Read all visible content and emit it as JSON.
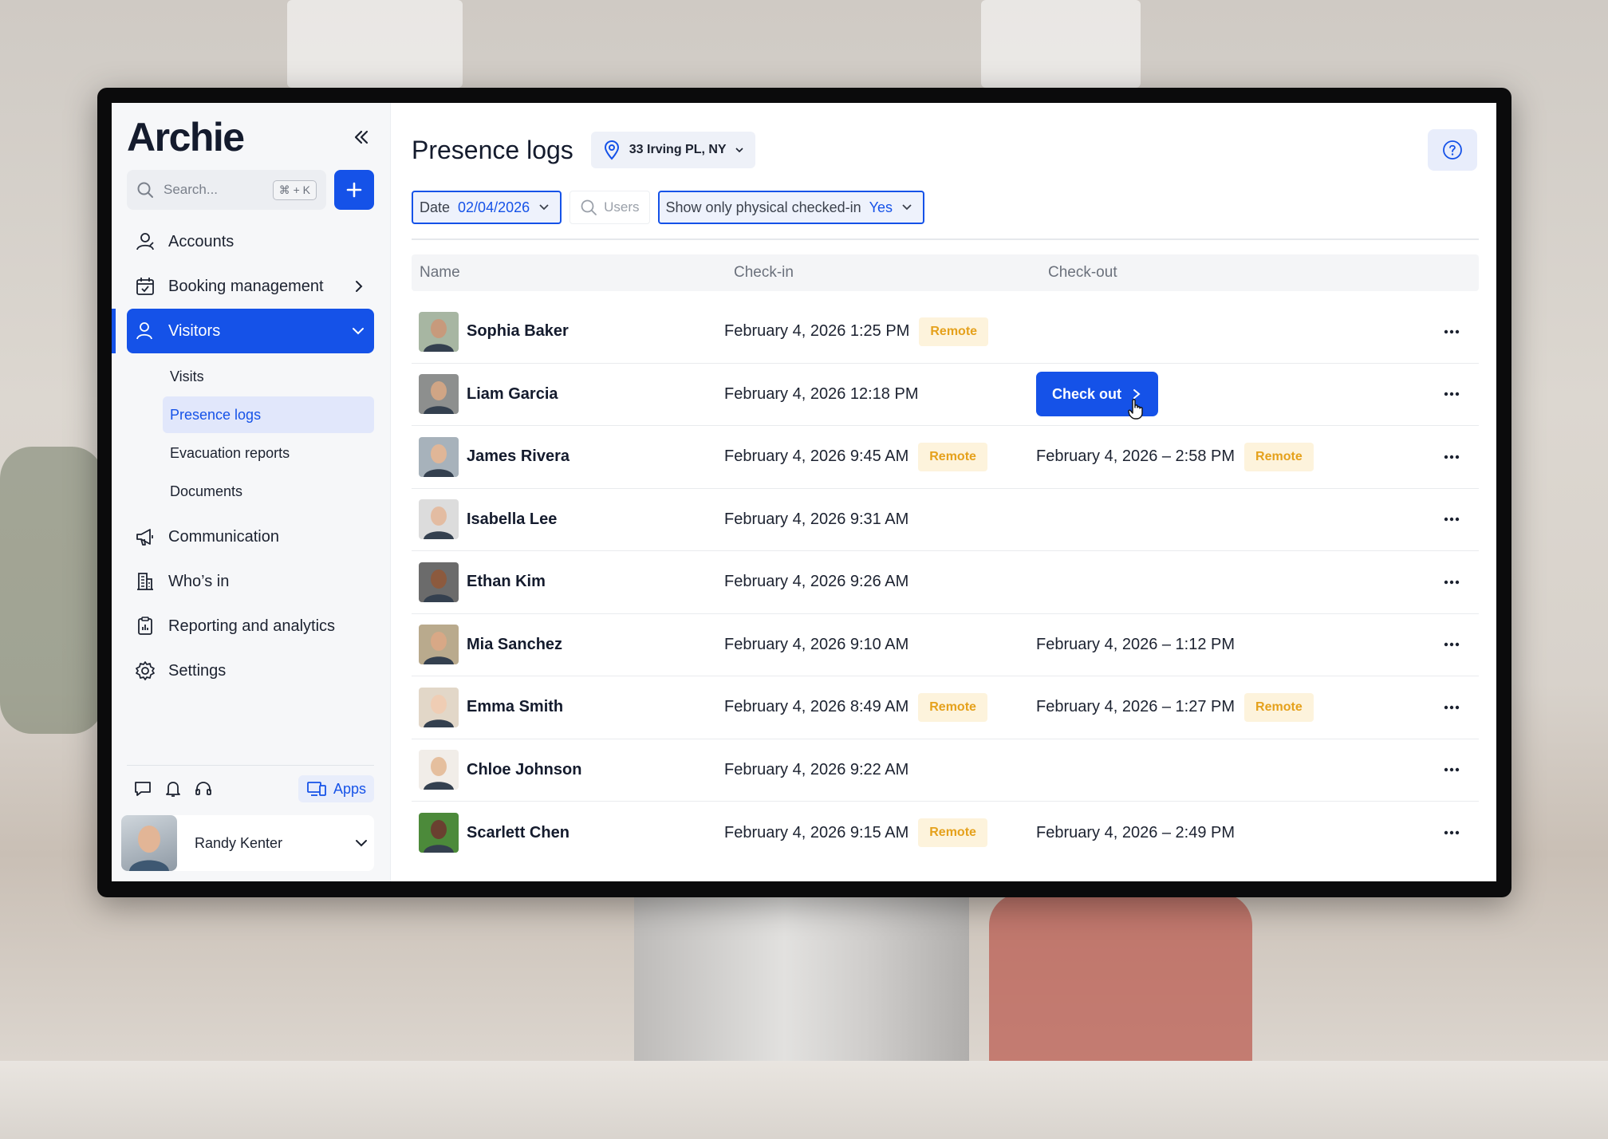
{
  "app": {
    "logo": "Archie"
  },
  "sidebar": {
    "search_placeholder": "Search...",
    "search_shortcut": "⌘ + K",
    "items": [
      {
        "label": "Accounts",
        "icon": "accounts-icon"
      },
      {
        "label": "Booking management",
        "icon": "calendar-icon"
      },
      {
        "label": "Visitors",
        "icon": "visitor-icon"
      },
      {
        "label": "Communication",
        "icon": "megaphone-icon"
      },
      {
        "label": "Who’s in",
        "icon": "building-icon"
      },
      {
        "label": "Reporting and analytics",
        "icon": "clipboard-icon"
      },
      {
        "label": "Settings",
        "icon": "gear-icon"
      }
    ],
    "visitors_sub": [
      {
        "label": "Visits"
      },
      {
        "label": "Presence logs",
        "active": true
      },
      {
        "label": "Evacuation reports"
      },
      {
        "label": "Documents"
      }
    ],
    "apps_label": "Apps",
    "user_name": "Randy Kenter"
  },
  "header": {
    "title": "Presence logs",
    "location": "33 Irving PL, NY"
  },
  "filters": {
    "date_label": "Date",
    "date_value": "02/04/2026",
    "users_placeholder": "Users",
    "physical_label": "Show only physical checked-in",
    "physical_value": "Yes"
  },
  "table": {
    "columns": [
      "Name",
      "Check-in",
      "Check-out"
    ],
    "remote_label": "Remote",
    "checkout_label": "Check out",
    "rows": [
      {
        "name": "Sophia Baker",
        "checkin": "February 4, 2026 1:25 PM",
        "checkin_remote": true,
        "checkout": "",
        "checkout_remote": false,
        "skin": "#c79a7c",
        "bg": "#a7b6a2"
      },
      {
        "name": "Liam Garcia",
        "checkin": "February 4, 2026 12:18 PM",
        "checkin_remote": false,
        "checkout": "",
        "checkout_remote": false,
        "show_checkout_btn": true,
        "skin": "#d0a585",
        "bg": "#8d8f8e"
      },
      {
        "name": "James Rivera",
        "checkin": "February 4, 2026 9:45 AM",
        "checkin_remote": true,
        "checkout": "February 4, 2026 – 2:58 PM",
        "checkout_remote": true,
        "skin": "#e0b697",
        "bg": "#a7b2bb"
      },
      {
        "name": "Isabella Lee",
        "checkin": "February 4, 2026 9:31 AM",
        "checkin_remote": false,
        "checkout": "",
        "checkout_remote": false,
        "skin": "#e3bca2",
        "bg": "#dcdcdc"
      },
      {
        "name": "Ethan Kim",
        "checkin": "February 4, 2026 9:26 AM",
        "checkin_remote": false,
        "checkout": "",
        "checkout_remote": false,
        "skin": "#8c5a3e",
        "bg": "#6b6b6b"
      },
      {
        "name": "Mia Sanchez",
        "checkin": "February 4, 2026 9:10 AM",
        "checkin_remote": false,
        "checkout": "February 4, 2026 – 1:12 PM",
        "checkout_remote": false,
        "skin": "#d8a886",
        "bg": "#b9aa8d"
      },
      {
        "name": "Emma Smith",
        "checkin": "February 4, 2026 8:49 AM",
        "checkin_remote": true,
        "checkout": "February 4, 2026 – 1:27 PM",
        "checkout_remote": true,
        "skin": "#efcdb4",
        "bg": "#e2d7c8"
      },
      {
        "name": "Chloe Johnson",
        "checkin": "February 4, 2026 9:22 AM",
        "checkin_remote": false,
        "checkout": "",
        "checkout_remote": false,
        "skin": "#e5bf9e",
        "bg": "#f1ede8"
      },
      {
        "name": "Scarlett Chen",
        "checkin": "February 4, 2026 9:15 AM",
        "checkin_remote": true,
        "checkout": "February 4, 2026 – 2:49 PM",
        "checkout_remote": false,
        "skin": "#6a4030",
        "bg": "#4c8a3a"
      }
    ]
  },
  "colors": {
    "accent": "#1552e8",
    "remote_badge_bg": "#fdf3dc",
    "remote_badge_text": "#e5a11c"
  }
}
